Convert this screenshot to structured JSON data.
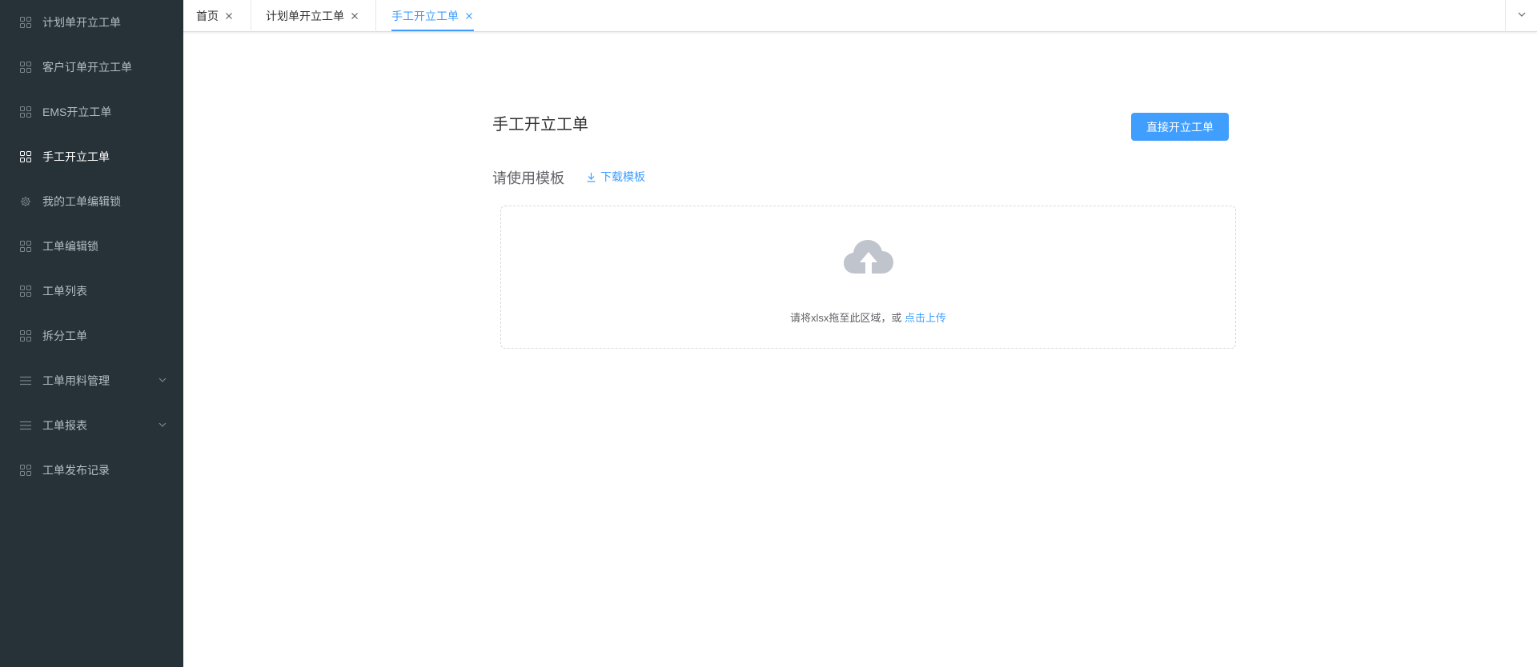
{
  "sidebar": {
    "items": [
      {
        "label": "计划单开立工单",
        "icon": "grid-icon"
      },
      {
        "label": "客户订单开立工单",
        "icon": "grid-icon"
      },
      {
        "label": "EMS开立工单",
        "icon": "grid-icon"
      },
      {
        "label": "手工开立工单",
        "icon": "grid-icon",
        "active": true
      },
      {
        "label": "我的工单编辑锁",
        "icon": "gear-icon"
      },
      {
        "label": "工单编辑锁",
        "icon": "grid-icon"
      },
      {
        "label": "工单列表",
        "icon": "grid-icon"
      },
      {
        "label": "拆分工单",
        "icon": "grid-icon"
      },
      {
        "label": "工单用料管理",
        "icon": "menu-icon",
        "submenu": true
      },
      {
        "label": "工单报表",
        "icon": "menu-icon",
        "submenu": true
      },
      {
        "label": "工单发布记录",
        "icon": "grid-icon"
      }
    ]
  },
  "tabs": [
    {
      "label": "首页"
    },
    {
      "label": "计划单开立工单"
    },
    {
      "label": "手工开立工单",
      "active": true
    }
  ],
  "main": {
    "title": "手工开立工单",
    "direct_button": "直接开立工单",
    "template_label": "请使用模板",
    "download_link": "下载模板",
    "upload_hint": "请将xlsx拖至此区域，或",
    "upload_link": "点击上传"
  },
  "colors": {
    "sidebar_bg": "#263238",
    "accent": "#409eff",
    "active_text": "#ffffff",
    "menu_text": "#b4bcc2"
  }
}
